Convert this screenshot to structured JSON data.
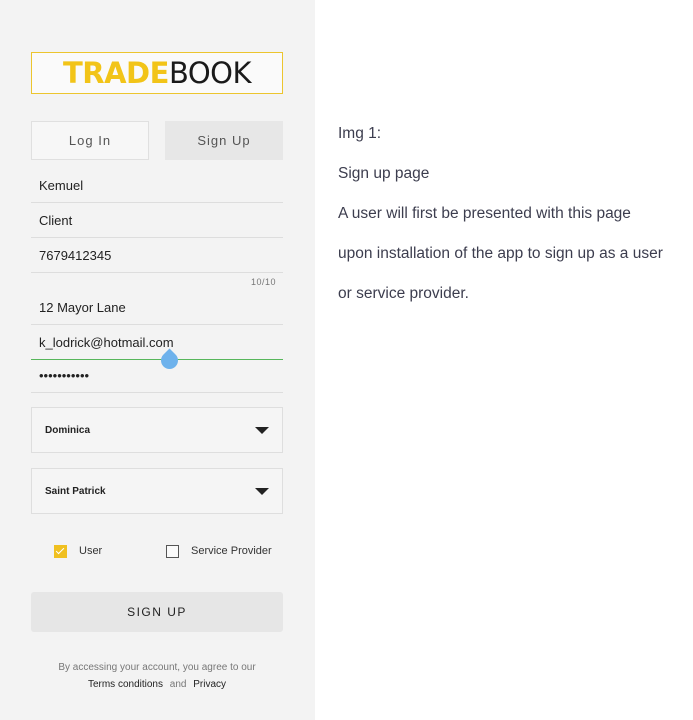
{
  "logo": {
    "trade": "TRADE",
    "book": "BOOK"
  },
  "tabs": {
    "login": "Log In",
    "signup": "Sign Up"
  },
  "fields": {
    "first_name": "Kemuel",
    "account_type": "Client",
    "phone": "7679412345",
    "phone_counter": "10/10",
    "address": "12 Mayor Lane",
    "email": "k_lodrick@hotmail.com",
    "password": "•••••••••••"
  },
  "selects": {
    "country": "Dominica",
    "parish": "Saint Patrick"
  },
  "roles": {
    "user_label": "User",
    "user_checked": true,
    "provider_label": "Service Provider",
    "provider_checked": false
  },
  "signup_button": "SIGN UP",
  "terms": {
    "prefix": "By accessing your account, you agree to our",
    "terms_link": "Terms conditions",
    "and": "and",
    "privacy_link": "Privacy"
  },
  "notes": [
    "Img 1:",
    "Sign up page",
    "A user will first be presented with this page",
    "upon installation of the app to sign up as a user",
    "or service provider."
  ],
  "colors": {
    "brand_yellow": "#f2c418",
    "focus_green": "#57b65b",
    "handle_blue": "#6eb2ec"
  }
}
